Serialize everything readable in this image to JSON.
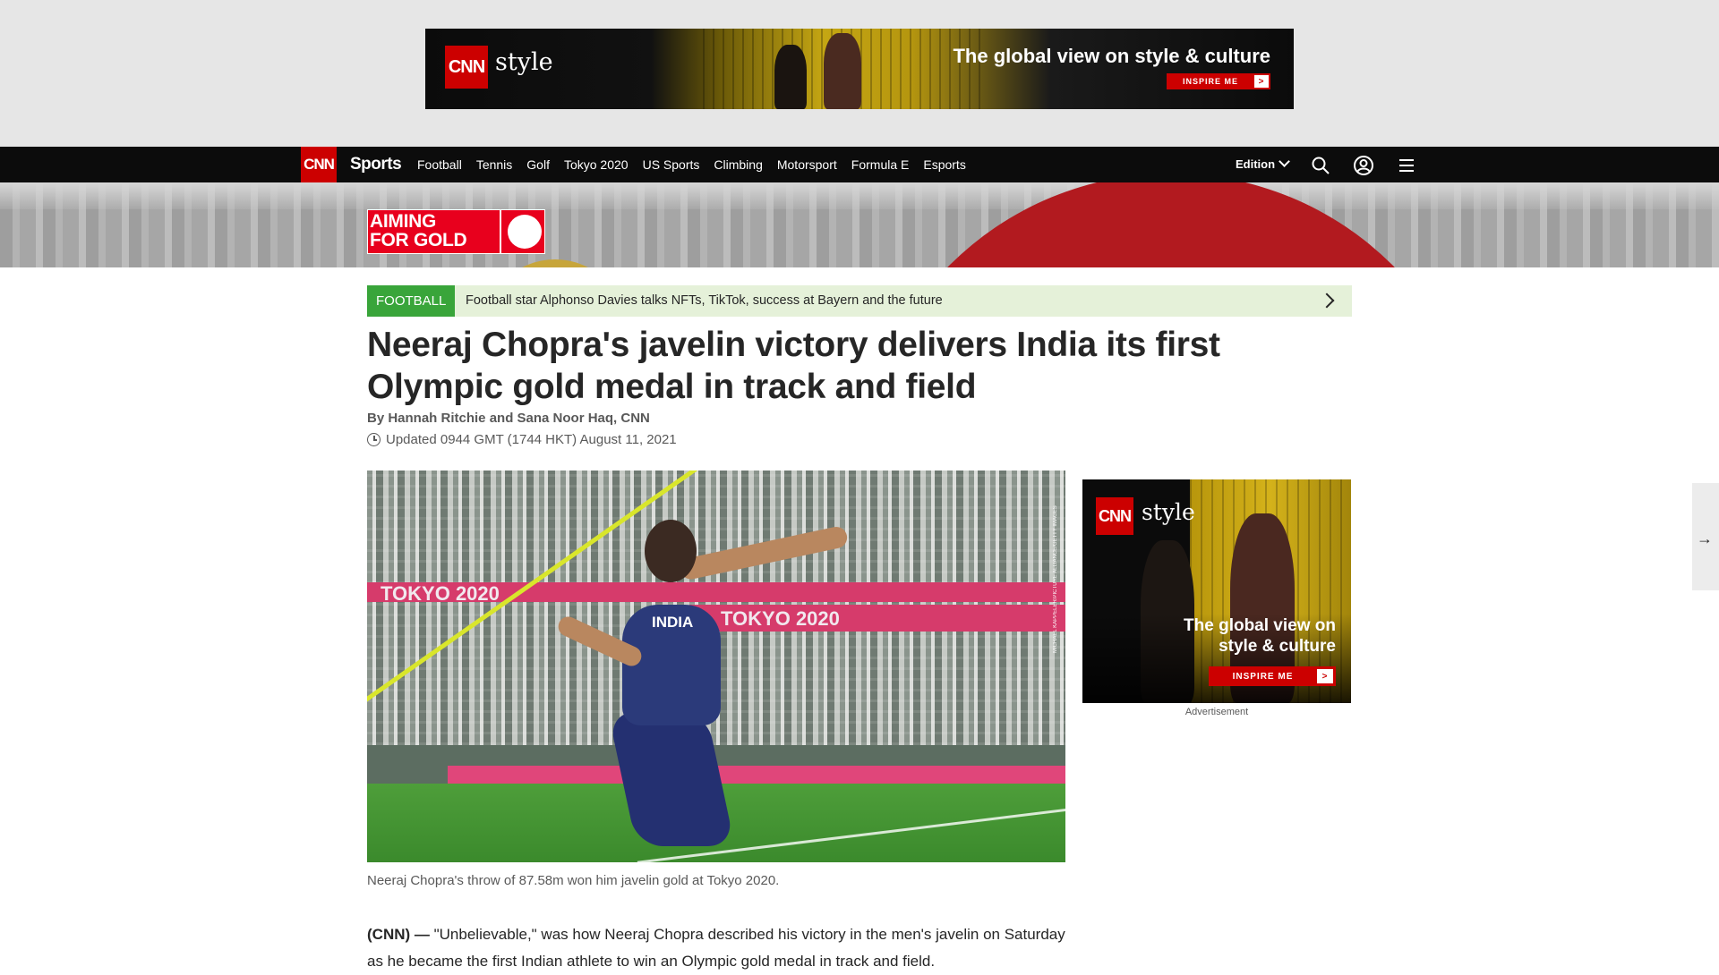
{
  "top_ad": {
    "logo": "CNN",
    "brand": "style",
    "tagline": "The global view on style & culture",
    "cta": "INSPIRE ME",
    "cta_arrow": ">"
  },
  "nav": {
    "logo": "CNN",
    "section": "Sports",
    "links": [
      "Football",
      "Tennis",
      "Golf",
      "Tokyo 2020",
      "US Sports",
      "Climbing",
      "Motorsport",
      "Formula E",
      "Esports"
    ],
    "edition": "Edition",
    "icons": [
      "search-icon",
      "account-icon",
      "menu-icon"
    ]
  },
  "hero": {
    "badge_line1": "AIMING",
    "badge_line2": "FOR GOLD",
    "colors": {
      "sun": "#b21a1f",
      "badge": "#e8001d"
    }
  },
  "strip": {
    "tag": "FOOTBALL",
    "text": "Football star Alphonso Davies talks NFTs, TikTok, success at Bayern and the future",
    "tag_color": "#39a53a",
    "bg_color": "#e5f1d9"
  },
  "article": {
    "headline": "Neeraj Chopra's javelin victory delivers India its first Olympic gold medal in track and field",
    "byline": "By Hannah Ritchie and Sana Noor Haq, CNN",
    "updated": "Updated 0944 GMT (1744 HKT) August 11, 2021",
    "photo_caption": "Neeraj Chopra's throw of 87.58m won him javelin gold at Tokyo 2020.",
    "photo_overlay": {
      "board_text": "TOKYO 2020",
      "jersey_text": "INDIA",
      "credit": "MICHAEL KAPPELER/PICTURE ALLIANCE/GETTY IMAGES"
    },
    "body_source": "(CNN) —",
    "body_text": "\"Unbelievable,\" was how Neeraj Chopra described his victory in the men's javelin on Saturday as he became the first Indian athlete to win an Olympic gold medal in track and field."
  },
  "side_ad": {
    "logo": "CNN",
    "brand": "style",
    "tagline": "The global view on style & culture",
    "cta": "INSPIRE ME",
    "cta_arrow": ">",
    "label": "Advertisement"
  },
  "next_arrow": "→"
}
